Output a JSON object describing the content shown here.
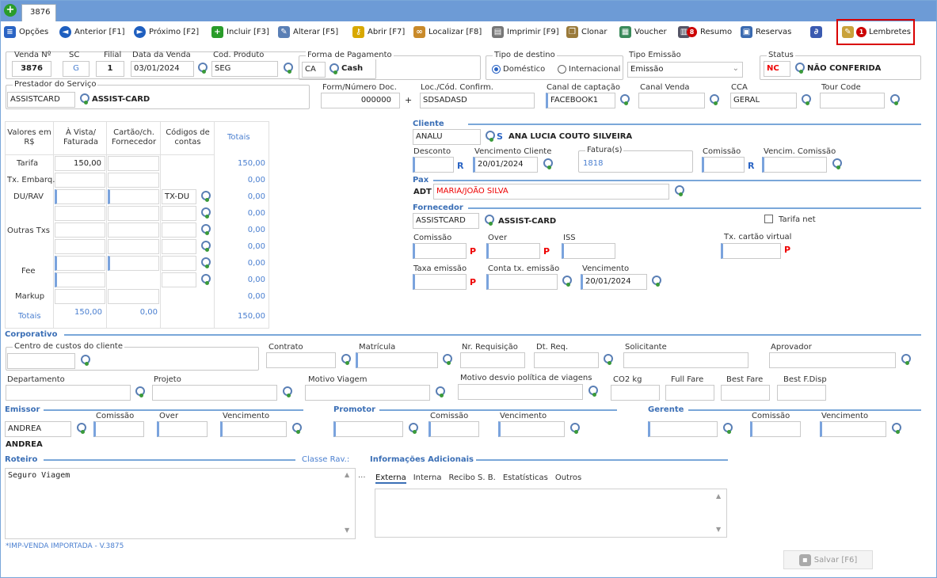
{
  "tab": {
    "title": "3876"
  },
  "toolbar": [
    {
      "id": "opcoes",
      "label": "Opções",
      "icon": "list-icon",
      "color": "#2a64c4"
    },
    {
      "id": "anterior",
      "label": "Anterior [F1]",
      "icon": "arrow-left-icon",
      "color": "#1f5fbf"
    },
    {
      "id": "proximo",
      "label": "Próximo [F2]",
      "icon": "arrow-right-icon",
      "color": "#1f5fbf"
    },
    {
      "id": "incluir",
      "label": "Incluir [F3]",
      "icon": "plus-icon",
      "color": "#2a9c2a"
    },
    {
      "id": "alterar",
      "label": "Alterar [F5]",
      "icon": "edit-icon",
      "color": "#5a7fb5"
    },
    {
      "id": "abrir",
      "label": "Abrir [F7]",
      "icon": "key-icon",
      "color": "#d8a800"
    },
    {
      "id": "localizar",
      "label": "Localizar [F8]",
      "icon": "binoculars-icon",
      "color": "#c98a2a"
    },
    {
      "id": "imprimir",
      "label": "Imprimir [F9]",
      "icon": "printer-icon",
      "color": "#777"
    },
    {
      "id": "clonar",
      "label": "Clonar",
      "icon": "clone-icon",
      "color": "#9a7a3a"
    },
    {
      "id": "voucher",
      "label": "Voucher",
      "icon": "voucher-icon",
      "color": "#3a8a5a"
    },
    {
      "id": "resumo",
      "label": "Resumo",
      "icon": "summary-icon",
      "color": "#556",
      "badge": "8"
    },
    {
      "id": "reservas",
      "label": "Reservas",
      "icon": "reservations-icon",
      "color": "#3a6ab0"
    },
    {
      "id": "anexo",
      "label": "",
      "icon": "paperclip-icon",
      "color": "#3a5ab0"
    }
  ],
  "lembretes": {
    "label": "Lembretes",
    "badge": "1"
  },
  "venda": {
    "label": "Venda Nº",
    "value": "3876"
  },
  "sc": {
    "label": "SC",
    "value": "G"
  },
  "filial": {
    "label": "Filial",
    "value": "1"
  },
  "data_venda": {
    "label": "Data da Venda",
    "value": "03/01/2024"
  },
  "cod_produto": {
    "label": "Cod. Produto",
    "value": "SEG"
  },
  "forma_pagamento": {
    "label": "Forma de Pagamento",
    "code": "CA",
    "name": "Cash"
  },
  "tipo_destino": {
    "label": "Tipo de destino",
    "opt1": "Doméstico",
    "opt2": "Internacional"
  },
  "tipo_emissao": {
    "label": "Tipo Emissão",
    "value": "Emissão"
  },
  "status": {
    "label": "Status",
    "code": "NC",
    "text": "NÃO CONFERIDA"
  },
  "prestador": {
    "label": "Prestador do Serviço",
    "code": "ASSISTCARD",
    "name": "ASSIST-CARD"
  },
  "form_num_doc": {
    "label": "Form/Número Doc.",
    "value": "000000",
    "plus": "+"
  },
  "loc_cod": {
    "label": "Loc./Cód. Confirm.",
    "value": "SDSADASD"
  },
  "canal_captacao": {
    "label": "Canal de captação",
    "value": "FACEBOOK1"
  },
  "canal_venda": {
    "label": "Canal Venda",
    "value": ""
  },
  "cca": {
    "label": "CCA",
    "value": "GERAL"
  },
  "tour_code": {
    "label": "Tour Code",
    "value": ""
  },
  "valores": {
    "h1": "Valores em R$",
    "h2": "À Vista/ Faturada",
    "h3": "Cartão/ch. Fornecedor",
    "h4": "Códigos de contas",
    "h5": "Totais",
    "r_tarifa": "Tarifa",
    "r_tx": "Tx. Embarq.",
    "r_du": "DU/RAV",
    "r_outras": "Outras Txs",
    "r_fee": "Fee",
    "r_markup": "Markup",
    "r_totais": "Totais",
    "tarifa_vista": "150,00",
    "du_code": "TX-DU",
    "totais": [
      "150,00",
      "0,00",
      "0,00",
      "0,00",
      "0,00",
      "0,00",
      "0,00",
      "0,00",
      "0,00",
      "0,00"
    ],
    "foot_vista": "150,00",
    "foot_cartao": "0,00",
    "foot_total": "150,00"
  },
  "cliente": {
    "section": "Cliente",
    "code": "ANALU",
    "flag": "S",
    "name": "ANA LUCIA COUTO SILVEIRA",
    "desconto": "Desconto",
    "venc_label": "Vencimento Cliente",
    "venc": "20/01/2024",
    "fatura_label": "Fatura(s)",
    "fatura": "1818",
    "comissao": "Comissão",
    "venc_comissao": "Vencim. Comissão",
    "R": "R"
  },
  "pax": {
    "section": "Pax",
    "type": "ADT",
    "name": "MARIA/JOÃO SILVA"
  },
  "fornecedor": {
    "section": "Fornecedor",
    "code": "ASSISTCARD",
    "name": "ASSIST-CARD",
    "tarifa_net": "Tarifa net",
    "comissao": "Comissão",
    "over": "Over",
    "iss": "ISS",
    "tx_cartao": "Tx. cartão virtual",
    "taxa_emissao": "Taxa emissão",
    "conta_tx": "Conta tx. emissão",
    "vencimento": "Vencimento",
    "venc": "20/01/2024",
    "P": "P"
  },
  "corporativo": {
    "section": "Corporativo",
    "centro": "Centro de custos do cliente",
    "contrato": "Contrato",
    "matricula": "Matrícula",
    "nr_req": "Nr. Requisição",
    "dt_req": "Dt. Req.",
    "solicitante": "Solicitante",
    "aprovador": "Aprovador",
    "departamento": "Departamento",
    "projeto": "Projeto",
    "motivo": "Motivo Viagem",
    "motivo_desvio": "Motivo desvio política de viagens",
    "co2": "CO2 kg",
    "full_fare": "Full Fare",
    "best_fare": "Best Fare",
    "best_fdisp": "Best F.Disp"
  },
  "emissor": {
    "section": "Emissor",
    "comissao": "Comissão",
    "over": "Over",
    "vencimento": "Vencimento",
    "value": "ANDREA",
    "name": "ANDREA"
  },
  "promotor": {
    "section": "Promotor",
    "comissao": "Comissão",
    "vencimento": "Vencimento"
  },
  "gerente": {
    "section": "Gerente",
    "comissao": "Comissão",
    "vencimento": "Vencimento"
  },
  "roteiro": {
    "section": "Roteiro",
    "classe": "Classe Rav.:",
    "text": "Seguro Viagem"
  },
  "info": {
    "section": "Informações Adicionais",
    "dots": "...",
    "tabs": [
      "Externa",
      "Interna",
      "Recibo S. B.",
      "Estatísticas",
      "Outros"
    ]
  },
  "footer": {
    "note": "*IMP-VENDA IMPORTADA - V.3875",
    "save": "Salvar [F6]"
  }
}
